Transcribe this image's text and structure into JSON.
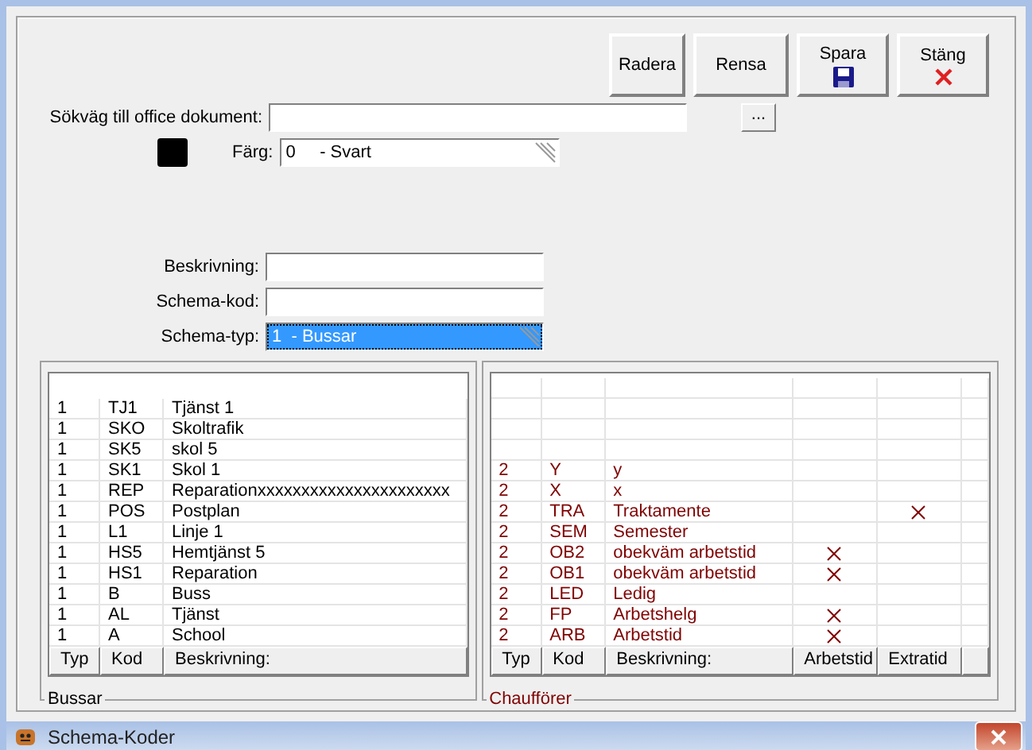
{
  "toolbar": [
    {
      "label": "Radera",
      "kind": "text"
    },
    {
      "label": "Rensa",
      "kind": "text"
    },
    {
      "label": "Spara",
      "kind": "save"
    },
    {
      "label": "Stäng",
      "kind": "close"
    }
  ],
  "path_field": {
    "label": "Sökväg till office dokument:",
    "browse": "..."
  },
  "color_field": {
    "label": "Färg:",
    "value": "0     - Svart",
    "color": "#000000"
  },
  "description_field": {
    "label": "Beskrivning:"
  },
  "code_field": {
    "label": "Schema-kod:"
  },
  "type_field": {
    "label": "Schema-typ:",
    "value": "1  - Bussar",
    "selected": true
  },
  "bussar": {
    "title": "Bussar",
    "columns": [
      "Typ",
      "Kod",
      "Beskrivning:"
    ],
    "rows": [
      {
        "typ": "1",
        "kod": "TJ1",
        "beskrivning": "Tjänst 1"
      },
      {
        "typ": "1",
        "kod": "SKO",
        "beskrivning": "Skoltrafik"
      },
      {
        "typ": "1",
        "kod": "SK5",
        "beskrivning": "skol 5"
      },
      {
        "typ": "1",
        "kod": "SK1",
        "beskrivning": "Skol 1"
      },
      {
        "typ": "1",
        "kod": "REP",
        "beskrivning": "Reparationxxxxxxxxxxxxxxxxxxxxxx"
      },
      {
        "typ": "1",
        "kod": "POS",
        "beskrivning": "Postplan"
      },
      {
        "typ": "1",
        "kod": "L1",
        "beskrivning": "Linje 1"
      },
      {
        "typ": "1",
        "kod": "HS5",
        "beskrivning": "Hemtjänst 5"
      },
      {
        "typ": "1",
        "kod": "HS1",
        "beskrivning": "Reparation"
      },
      {
        "typ": "1",
        "kod": "B",
        "beskrivning": "Buss"
      },
      {
        "typ": "1",
        "kod": "AL",
        "beskrivning": "Tjänst"
      },
      {
        "typ": "1",
        "kod": "A",
        "beskrivning": "School"
      }
    ]
  },
  "chauffoerer": {
    "title": "Chaufförer",
    "columns": [
      "Typ",
      "Kod",
      "Beskrivning:",
      "Arbetstid",
      "Extratid"
    ],
    "rows": [
      {
        "typ": "2",
        "kod": "Y",
        "beskrivning": "y",
        "arbetstid": false,
        "extratid": false
      },
      {
        "typ": "2",
        "kod": "X",
        "beskrivning": "x",
        "arbetstid": false,
        "extratid": false
      },
      {
        "typ": "2",
        "kod": "TRA",
        "beskrivning": "Traktamente",
        "arbetstid": false,
        "extratid": true
      },
      {
        "typ": "2",
        "kod": "SEM",
        "beskrivning": "Semester",
        "arbetstid": false,
        "extratid": false
      },
      {
        "typ": "2",
        "kod": "OB2",
        "beskrivning": "obekväm arbetstid",
        "arbetstid": true,
        "extratid": false
      },
      {
        "typ": "2",
        "kod": "OB1",
        "beskrivning": "obekväm arbetstid",
        "arbetstid": true,
        "extratid": false
      },
      {
        "typ": "2",
        "kod": "LED",
        "beskrivning": "Ledig",
        "arbetstid": false,
        "extratid": false
      },
      {
        "typ": "2",
        "kod": "FP",
        "beskrivning": "Arbetshelg",
        "arbetstid": true,
        "extratid": false
      },
      {
        "typ": "2",
        "kod": "ARB",
        "beskrivning": "Arbetstid",
        "arbetstid": true,
        "extratid": false
      }
    ]
  },
  "window": {
    "title": "Schema-Koder"
  }
}
